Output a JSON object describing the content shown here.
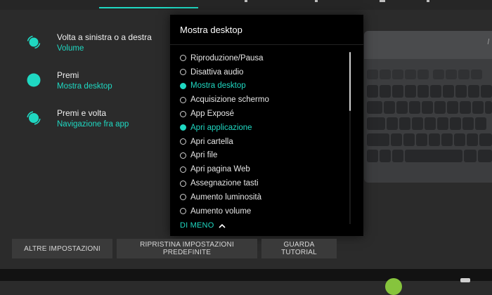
{
  "actions": [
    {
      "title": "Volta a sinistra o a destra",
      "value": "Volume"
    },
    {
      "title": "Premi",
      "value": "Mostra desktop"
    },
    {
      "title": "Premi e volta",
      "value": "Navigazione fra app"
    }
  ],
  "overlay": {
    "title": "Mostra desktop",
    "options": [
      {
        "label": "Riproduzione/Pausa",
        "selected": false
      },
      {
        "label": "Disattiva audio",
        "selected": false
      },
      {
        "label": "Mostra desktop",
        "selected": true
      },
      {
        "label": "Acquisizione schermo",
        "selected": false
      },
      {
        "label": "App Exposé",
        "selected": false
      },
      {
        "label": "Apri applicazione",
        "selected": true
      },
      {
        "label": "Apri cartella",
        "selected": false
      },
      {
        "label": "Apri file",
        "selected": false
      },
      {
        "label": "Apri pagina Web",
        "selected": false
      },
      {
        "label": "Assegnazione tasti",
        "selected": false
      },
      {
        "label": "Aumento luminosità",
        "selected": false
      },
      {
        "label": "Aumento volume",
        "selected": false
      }
    ],
    "less_label": "DI MENO"
  },
  "buttons": {
    "more_settings": "ALTRE IMPOSTAZIONI",
    "restore_defaults": "RIPRISTINA IMPOSTAZIONI PREDEFINITE",
    "tutorial": "GUARDA TUTORIAL"
  },
  "colors": {
    "accent": "#1fd8c2",
    "background": "#2b2b2b",
    "dropdown_background": "#000000"
  },
  "icons": {
    "rotate": "dial-rotate-icon",
    "press": "dial-press-icon",
    "press_rotate": "dial-press-rotate-icon",
    "collapse": "chevron-up-icon"
  }
}
